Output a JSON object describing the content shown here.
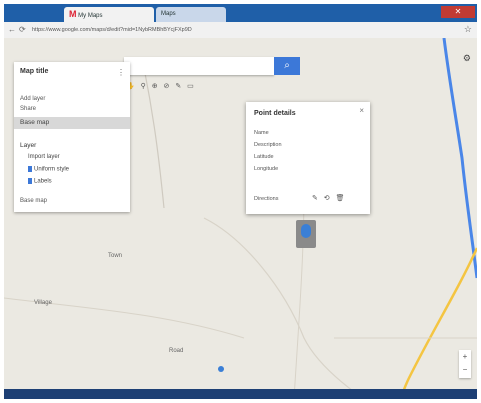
{
  "browser": {
    "tab_label": "My Maps",
    "tab2_label": "Maps",
    "address": "https://www.google.com/maps/d/edit?mid=1NybRMBhBYcjFXp9D",
    "window_close": "✕"
  },
  "search": {
    "placeholder": "",
    "button_icon": "search-icon"
  },
  "tools": "✋ ⚲ ⊕ ⊘ ✎ ▭",
  "panel": {
    "title": "Map title",
    "subtitle": "",
    "menu": "⋮",
    "row1": "Add layer",
    "row2": "Share",
    "selected_layer": "Base map",
    "layer_heading": "Layer",
    "layer_items": [
      "Import layer",
      "Uniform style",
      "Labels"
    ],
    "footer": "Base map"
  },
  "popup": {
    "title": "Point details",
    "close": "×",
    "rows": [
      {
        "k": "Name",
        "v": ""
      },
      {
        "k": "Description",
        "v": ""
      },
      {
        "k": "Latitude",
        "v": ""
      },
      {
        "k": "Longitude",
        "v": ""
      }
    ],
    "footer": "Directions",
    "icons": "✎ ⟲ 🗑"
  },
  "map_labels": [
    "Town",
    "Village",
    "Road"
  ],
  "zoom": {
    "in": "+",
    "out": "−"
  },
  "colors": {
    "accent": "#3c78d8",
    "water": "#4a86e8",
    "road": "#f4c542"
  }
}
